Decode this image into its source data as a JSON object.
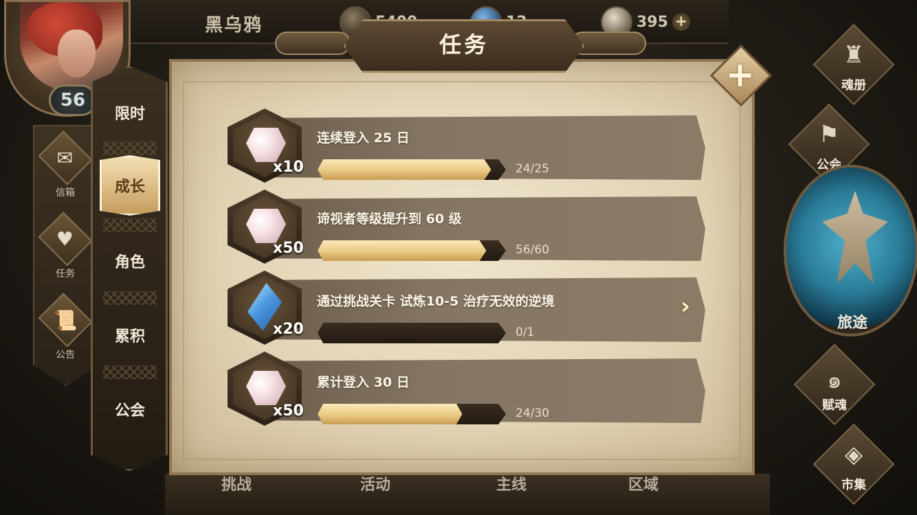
{
  "player": {
    "name": "黑乌鸦",
    "level": "56"
  },
  "currencies": [
    {
      "icon": "gold-coin-icon",
      "value": "5400"
    },
    {
      "icon": "blue-crystal-icon",
      "value": "12"
    },
    {
      "icon": "soul-stone-icon",
      "value": "395"
    }
  ],
  "left_menu": [
    {
      "label": "信箱",
      "icon": "mail-icon"
    },
    {
      "label": "任务",
      "icon": "quest-icon"
    },
    {
      "label": "公告",
      "icon": "notice-icon"
    }
  ],
  "panel": {
    "title": "任务",
    "close_icon": "close-icon"
  },
  "tabs": [
    {
      "label": "限时",
      "active": false
    },
    {
      "label": "成长",
      "active": true
    },
    {
      "label": "角色",
      "active": false
    },
    {
      "label": "累积",
      "active": false
    },
    {
      "label": "公会",
      "active": false
    }
  ],
  "tasks": [
    {
      "title": "连续登入 25 日",
      "reward_icon": "pink-gem-icon",
      "reward_qty": "x10",
      "progress_text": "24/25",
      "progress": 0.96
    },
    {
      "title": "谛视者等级提升到 60 级",
      "reward_icon": "pink-gem-icon",
      "reward_qty": "x50",
      "progress_text": "56/60",
      "progress": 0.933
    },
    {
      "title": "通过挑战关卡 试炼10-5 治疗无效的逆境",
      "reward_icon": "blue-crystal-icon",
      "reward_qty": "x20",
      "progress_text": "0/1",
      "progress": 0
    },
    {
      "title": "累计登入 30 日",
      "reward_icon": "pink-gem-icon",
      "reward_qty": "x50",
      "progress_text": "24/30",
      "progress": 0.8
    }
  ],
  "bottom_nav": [
    "挑战",
    "活动",
    "主线",
    "区域"
  ],
  "right_menu": [
    {
      "label": "魂册",
      "icon": "helmet-icon"
    },
    {
      "label": "公会",
      "icon": "guild-banner-icon"
    },
    {
      "label": "旅途",
      "icon": "journey-emblem-icon"
    },
    {
      "label": "赋魂",
      "icon": "swirl-icon"
    },
    {
      "label": "市集",
      "icon": "market-gem-icon"
    }
  ],
  "colors": {
    "parchment": "#e2d4b6",
    "progress_fill": "#e9c982",
    "active_tab": "#f3dfb2"
  }
}
